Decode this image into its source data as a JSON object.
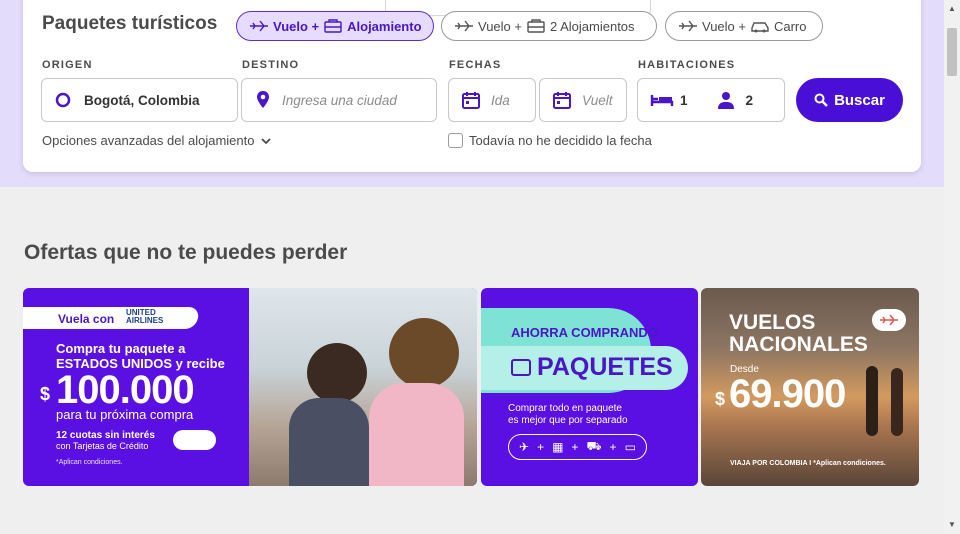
{
  "search": {
    "title": "Paquetes turísticos",
    "tabs": [
      {
        "label": "Vuelo + ",
        "suffix": "Alojamiento",
        "active": true
      },
      {
        "label": "Vuelo + ",
        "suffix": "2 Alojamientos",
        "active": false
      },
      {
        "label": "Vuelo + ",
        "suffix": "Carro",
        "active": false
      }
    ],
    "labels": {
      "origin": "ORIGEN",
      "destination": "DESTINO",
      "dates": "FECHAS",
      "rooms": "HABITACIONES"
    },
    "origin_value": "Bogotá, Colombia",
    "destination_placeholder": "Ingresa una ciudad",
    "departure_placeholder": "Ida",
    "return_placeholder": "Vuelt",
    "rooms_count": "1",
    "guests_count": "2",
    "search_button": "Buscar",
    "advanced_options": "Opciones avanzadas del alojamiento",
    "undecided_date": "Todavía no he decidido la fecha"
  },
  "offers": {
    "title": "Ofertas que no te puedes perder",
    "banner1": {
      "tag": "Vuela con",
      "airline_line1": "UNITED",
      "airline_line2": "AIRLINES",
      "headline1": "Compra tu paquete a",
      "headline2": "ESTADOS UNIDOS y recibe",
      "currency": "$",
      "amount": "100.000",
      "sub": "para tu próxima compra",
      "cuotas1": "12 cuotas sin interés",
      "cuotas2": "con Tarjetas de Crédito",
      "fine": "*Aplican condiciones."
    },
    "banner2": {
      "headline": "AHORRA COMPRANDO",
      "big": "PAQUETES",
      "text1": "Comprar todo en paquete",
      "text2": "es mejor que por separado"
    },
    "banner3": {
      "line1": "VUELOS",
      "line2": "NACIONALES",
      "desde": "Desde",
      "currency": "$",
      "price": "69.900",
      "fine": "VIAJA POR COLOMBIA I *Aplican condiciones."
    }
  },
  "colors": {
    "brand": "#4a0fd6",
    "band": "#e4dcfb",
    "accent_teal": "#7ee2d5"
  }
}
